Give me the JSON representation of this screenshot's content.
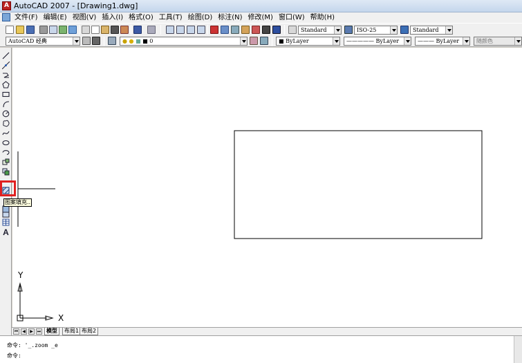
{
  "window": {
    "title": "AutoCAD 2007 - [Drawing1.dwg]",
    "app_icon_glyph": "A"
  },
  "menu": [
    "文件(F)",
    "编辑(E)",
    "视图(V)",
    "插入(I)",
    "格式(O)",
    "工具(T)",
    "绘图(D)",
    "标注(N)",
    "修改(M)",
    "窗口(W)",
    "帮助(H)"
  ],
  "styles_toolbar": {
    "text_style": "Standard",
    "dim_style": "ISO-25",
    "table_style": "Standard"
  },
  "workspace": "AutoCAD 经典",
  "layer": {
    "name": "0"
  },
  "properties": {
    "color": "ByLayer",
    "linetype": "ByLayer",
    "lineweight": "ByLayer",
    "plot_style": "随颜色"
  },
  "draw_tools": [
    "line-icon",
    "construction-line-icon",
    "polyline-icon",
    "polygon-icon",
    "rectangle-icon",
    "arc-icon",
    "circle-icon",
    "revision-cloud-icon",
    "spline-icon",
    "ellipse-icon",
    "ellipse-arc-icon",
    "insert-block-icon",
    "make-block-icon",
    "hatch-icon",
    "gradient-icon",
    "region-icon",
    "table-icon",
    "multiline-text-icon"
  ],
  "tooltip": "图案填充...",
  "ucs": {
    "x_label": "X",
    "y_label": "Y"
  },
  "layout_tabs": [
    "模型",
    "布局1",
    "布局2"
  ],
  "active_tab": "模型",
  "command": {
    "history": "命令: '_.zoom _e",
    "prompt": "命令:"
  },
  "colors": {
    "canvas_bg": "#ffffff",
    "highlight": "#e02020",
    "tooltip_bg": "#ffffe1"
  }
}
